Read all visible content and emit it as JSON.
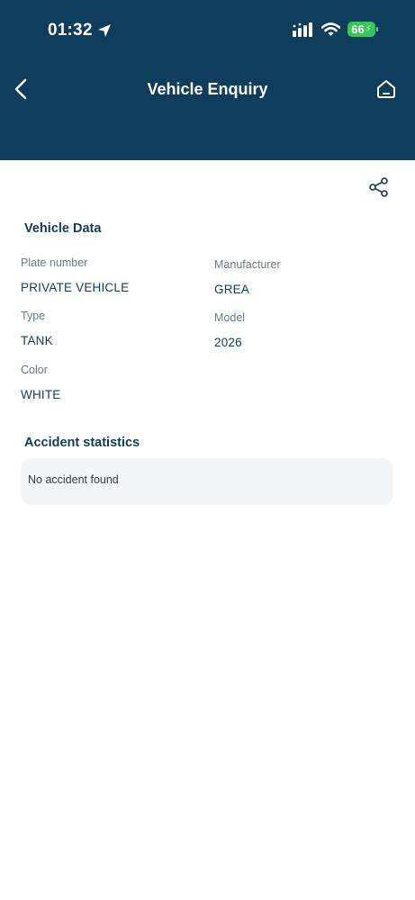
{
  "status_bar": {
    "time": "01:32",
    "battery": "66",
    "battery_color": "#34c759"
  },
  "header": {
    "title": "Vehicle Enquiry",
    "background_color": "#0f3d5e"
  },
  "vehicle_data": {
    "section_title": "Vehicle Data",
    "fields": [
      {
        "label": "Plate number",
        "value": "PRIVATE VEHICLE"
      },
      {
        "label": "Manufacturer",
        "value": "GREA"
      },
      {
        "label": "Type",
        "value": "TANK"
      },
      {
        "label": "Model",
        "value": "2026"
      },
      {
        "label": "Color",
        "value": "WHITE"
      }
    ]
  },
  "accident_statistics": {
    "section_title": "Accident statistics",
    "message": "No accident found"
  },
  "icons": {
    "back": "chevron-left-icon",
    "home": "home-icon",
    "share": "share-icon",
    "location": "location-arrow-icon",
    "signal": "signal-icon",
    "wifi": "wifi-icon"
  }
}
